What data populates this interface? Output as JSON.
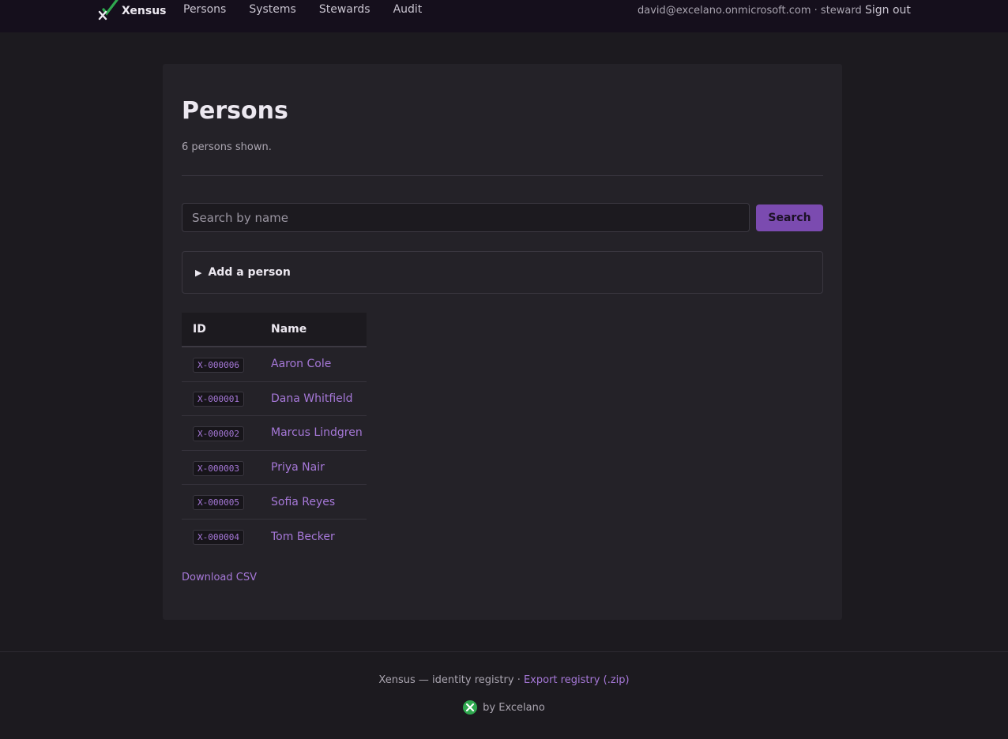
{
  "header": {
    "brand": "Xensus",
    "nav": [
      "Persons",
      "Systems",
      "Stewards",
      "Audit"
    ],
    "account": "david@excelano.onmicrosoft.com · steward",
    "signout": "Sign out"
  },
  "main": {
    "title": "Persons",
    "count": "6 persons shown.",
    "search": {
      "placeholder": "Search by name",
      "value": "",
      "button": "Search"
    },
    "add_person": {
      "arrow": "▶",
      "label": "Add a person"
    },
    "table": {
      "columns": [
        "ID",
        "Name"
      ],
      "rows": [
        {
          "id": "X-000006",
          "name": "Aaron Cole"
        },
        {
          "id": "X-000001",
          "name": "Dana Whitfield"
        },
        {
          "id": "X-000002",
          "name": "Marcus Lindgren"
        },
        {
          "id": "X-000003",
          "name": "Priya Nair"
        },
        {
          "id": "X-000005",
          "name": "Sofia Reyes"
        },
        {
          "id": "X-000004",
          "name": "Tom Becker"
        }
      ]
    },
    "download": "Download CSV"
  },
  "footer": {
    "text": "Xensus — identity registry · ",
    "export": "Export registry (.zip)",
    "by": "by Excelano"
  },
  "colors": {
    "accent": "#7b4bb0",
    "link": "#a678d8",
    "logo_green": "#2fa84f"
  }
}
